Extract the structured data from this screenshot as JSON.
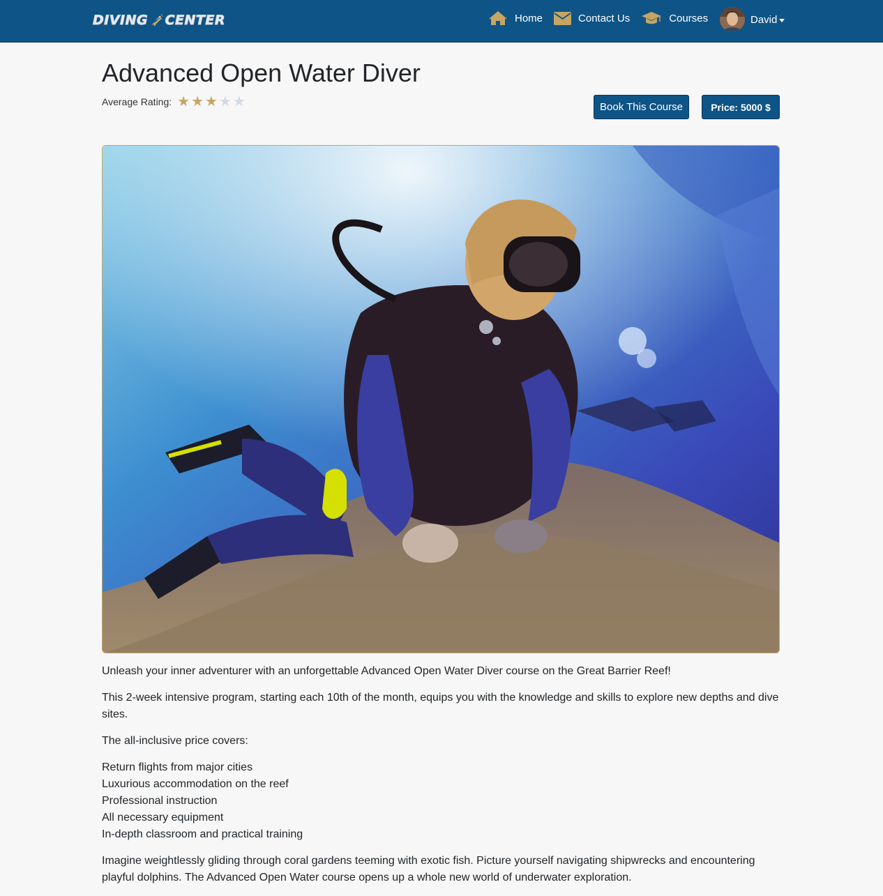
{
  "navbar": {
    "logo_text_left": "DIVING",
    "logo_text_right": "CENTER",
    "links": [
      {
        "label": "Home",
        "icon": "home-icon"
      },
      {
        "label": "Contact Us",
        "icon": "envelope-icon"
      },
      {
        "label": "Courses",
        "icon": "graduation-cap-icon"
      }
    ],
    "user": {
      "name": "David",
      "icon": "avatar"
    }
  },
  "course": {
    "title": "Advanced Open Water Diver",
    "rating_label": "Average Rating:",
    "rating": 3,
    "rating_max": 5,
    "book_label": "Book This Course",
    "price_label": "Price: 5000 $"
  },
  "description": {
    "paragraphs": [
      "Unleash your inner adventurer with an unforgettable Advanced Open Water Diver course on the Great Barrier Reef!",
      "This 2-week intensive program, starting each 10th of the month, equips you with the knowledge and skills to explore new depths and dive sites.",
      "The all-inclusive price covers:"
    ],
    "includes": [
      "Return flights from major cities",
      "Luxurious accommodation on the reef",
      "Professional instruction",
      "All necessary equipment",
      "In-depth classroom and practical training"
    ],
    "closing": "Imagine weightlessly gliding through coral gardens teeming with exotic fish. Picture yourself navigating shipwrecks and encountering playful dolphins. The Advanced Open Water course opens up a whole new world of underwater exploration."
  },
  "colors": {
    "navbar": "#0e5486",
    "accent_gold": "#c6a563",
    "background": "#f7f7f7"
  }
}
